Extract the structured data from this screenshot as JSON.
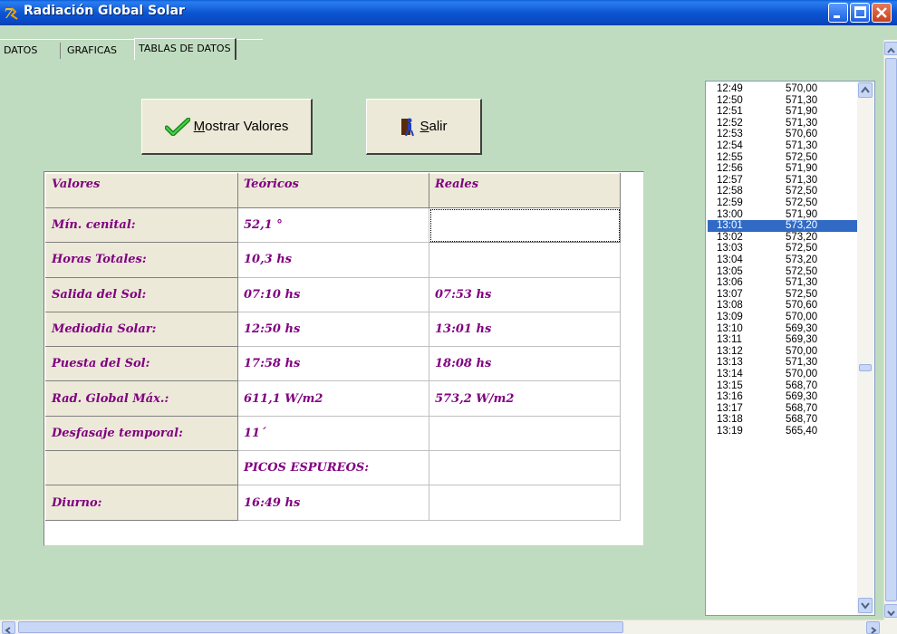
{
  "window": {
    "title": "Radiación Global Solar"
  },
  "tabs": [
    {
      "label": "DATOS"
    },
    {
      "label": "GRAFICAS"
    },
    {
      "label": "TABLAS DE DATOS"
    }
  ],
  "buttons": {
    "show_mnemonic": "M",
    "show_rest": "ostrar Valores",
    "exit_mnemonic": "S",
    "exit_rest": "alir"
  },
  "grid": {
    "headers": [
      "Valores",
      "Teóricos",
      "Reales"
    ],
    "rows": [
      [
        "Mín. cenital:",
        "52,1 °",
        ""
      ],
      [
        "Horas Totales:",
        "10,3 hs",
        ""
      ],
      [
        "Salida del Sol:",
        "07:10 hs",
        "07:53 hs"
      ],
      [
        "Mediodia Solar:",
        "12:50 hs",
        "13:01 hs"
      ],
      [
        "Puesta del Sol:",
        "17:58 hs",
        "18:08 hs"
      ],
      [
        "Rad. Global Máx.:",
        "611,1 W/m2",
        "573,2 W/m2"
      ],
      [
        "Desfasaje temporal:",
        "11´",
        ""
      ],
      [
        "",
        "PICOS ESPUREOS:",
        ""
      ],
      [
        "Diurno:",
        "16:49 hs",
        ""
      ]
    ]
  },
  "listbox": {
    "selected_index": 12,
    "items": [
      [
        "12:49",
        "570,00"
      ],
      [
        "12:50",
        "571,30"
      ],
      [
        "12:51",
        "571,90"
      ],
      [
        "12:52",
        "571,30"
      ],
      [
        "12:53",
        "570,60"
      ],
      [
        "12:54",
        "571,30"
      ],
      [
        "12:55",
        "572,50"
      ],
      [
        "12:56",
        "571,90"
      ],
      [
        "12:57",
        "571,30"
      ],
      [
        "12:58",
        "572,50"
      ],
      [
        "12:59",
        "572,50"
      ],
      [
        "13:00",
        "571,90"
      ],
      [
        "13:01",
        "573,20"
      ],
      [
        "13:02",
        "573,20"
      ],
      [
        "13:03",
        "572,50"
      ],
      [
        "13:04",
        "573,20"
      ],
      [
        "13:05",
        "572,50"
      ],
      [
        "13:06",
        "571,30"
      ],
      [
        "13:07",
        "572,50"
      ],
      [
        "13:08",
        "570,60"
      ],
      [
        "13:09",
        "570,00"
      ],
      [
        "13:10",
        "569,30"
      ],
      [
        "13:11",
        "569,30"
      ],
      [
        "13:12",
        "570,00"
      ],
      [
        "13:13",
        "571,30"
      ],
      [
        "13:14",
        "570,00"
      ],
      [
        "13:15",
        "568,70"
      ],
      [
        "13:16",
        "569,30"
      ],
      [
        "13:17",
        "568,70"
      ],
      [
        "13:18",
        "568,70"
      ],
      [
        "13:19",
        "565,40"
      ]
    ]
  },
  "colors": {
    "background": "#c0dcc0",
    "grid_text": "#800080",
    "selection": "#316ac5"
  },
  "icons": {
    "app": "solar-app-icon",
    "show": "checkmark-icon",
    "exit": "exit-door-icon"
  }
}
